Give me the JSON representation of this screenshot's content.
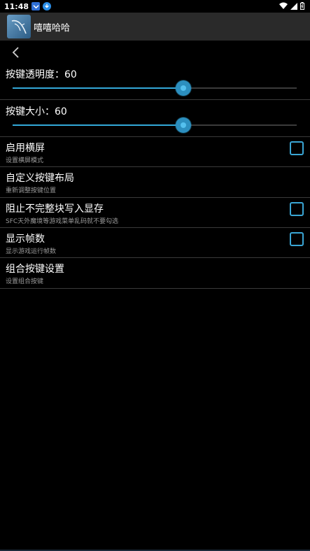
{
  "status_bar": {
    "time": "11:48"
  },
  "app_bar": {
    "title": "嘻嘻哈哈"
  },
  "settings": {
    "transparency": {
      "label": "按键透明度：",
      "value": "60",
      "fraction": 0.6
    },
    "size": {
      "label": "按键大小：",
      "value": "60",
      "fraction": 0.6
    },
    "landscape": {
      "title": "启用横屏",
      "summary": "设置横屏模式",
      "checked": false
    },
    "custom_layout": {
      "title": "自定义按键布局",
      "summary": "重新调整按键位置"
    },
    "block_incomplete": {
      "title": "阻止不完整块写入显存",
      "summary": "SFC天外魔境等游戏菜单乱码就不要勾选",
      "checked": false
    },
    "show_fps": {
      "title": "显示帧数",
      "summary": "显示游戏运行帧数",
      "checked": false
    },
    "combo_keys": {
      "title": "组合按键设置",
      "summary": "设置组合按键"
    }
  },
  "colors": {
    "accent": "#33a8d8",
    "app_bar": "#2a2a2a",
    "background": "#000000"
  }
}
